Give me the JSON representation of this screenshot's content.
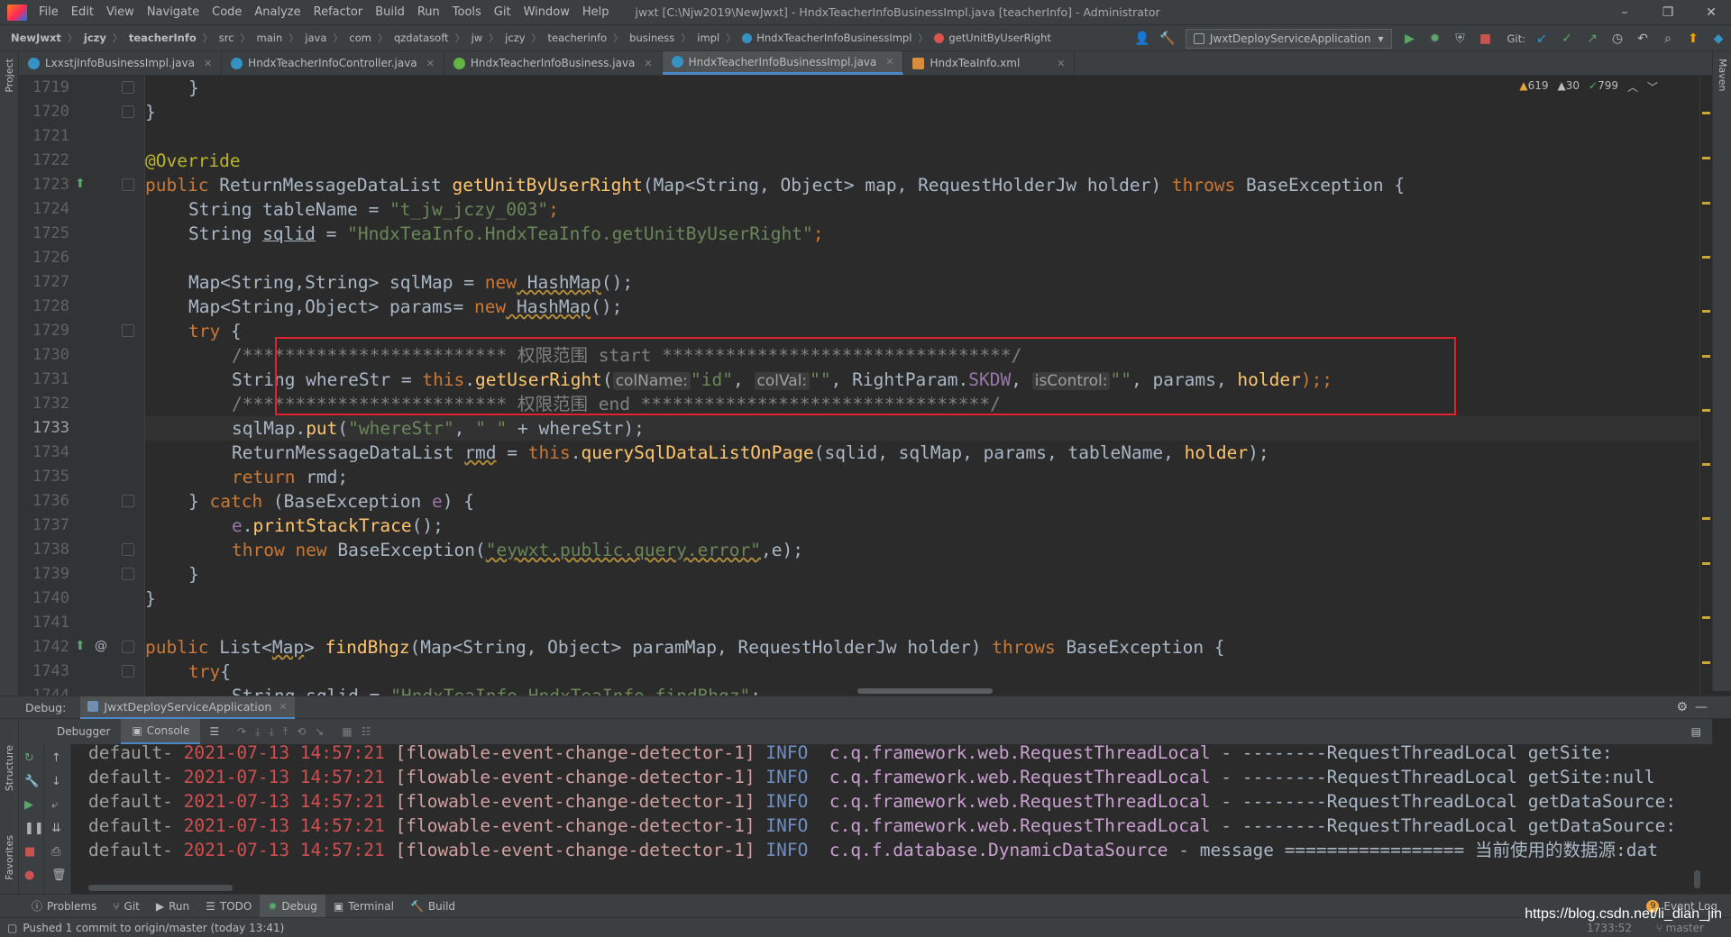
{
  "menu": {
    "items": [
      "File",
      "Edit",
      "View",
      "Navigate",
      "Code",
      "Analyze",
      "Refactor",
      "Build",
      "Run",
      "Tools",
      "Git",
      "Window",
      "Help"
    ],
    "title": "jwxt [C:\\Njw2019\\NewJwxt] - HndxTeacherInfoBusinessImpl.java [teacherInfo] - Administrator",
    "minimize": "–",
    "maximize": "❐",
    "close": "✕"
  },
  "breadcrumb": [
    "NewJwxt",
    "jczy",
    "teacherInfo",
    "src",
    "main",
    "java",
    "com",
    "qzdatasoft",
    "jw",
    "jczy",
    "teacherinfo",
    "business",
    "impl",
    "HndxTeacherInfoBusinessImpl",
    "getUnitByUserRight"
  ],
  "toolbar": {
    "run_config": "JwxtDeployServiceApplication",
    "git_label": "Git:"
  },
  "tabs": [
    {
      "label": "LxxstjInfoBusinessImpl.java",
      "color": "#3592c4"
    },
    {
      "label": "HndxTeacherInfoController.java",
      "color": "#3592c4"
    },
    {
      "label": "HndxTeacherInfoBusiness.java",
      "color": "#62b543"
    },
    {
      "label": "HndxTeacherInfoBusinessImpl.java",
      "color": "#3592c4"
    },
    {
      "label": "HndxTeaInfo.xml",
      "color": "#d88c3d"
    }
  ],
  "inspections": {
    "warnings": "619",
    "weak_warnings": "30",
    "ok": "799"
  },
  "side_labels": {
    "project": "Project",
    "structure": "Structure",
    "favorites": "Favorites",
    "maven": "Maven"
  },
  "line_numbers": [
    "1719",
    "1720",
    "1721",
    "1722",
    "1723",
    "1724",
    "1725",
    "1726",
    "1727",
    "1728",
    "1729",
    "1730",
    "1731",
    "1732",
    "1733",
    "1734",
    "1735",
    "1736",
    "1737",
    "1738",
    "1739",
    "1740",
    "1741",
    "1742",
    "1743",
    "1744"
  ],
  "code": {
    "l1719": "}",
    "l1720": "}",
    "l1722": "@Override",
    "l1723_kw": "public",
    "l1723_type": "ReturnMessageDataList",
    "l1723_fn": "getUnitByUserRight",
    "l1723_args": "(Map<String, Object> map, RequestHolderJw holder)",
    "l1723_throws": "throws",
    "l1723_exc": "BaseException {",
    "l1724_a": "String tableName = ",
    "l1724_s": "\"t_jw_jczy_003\"",
    "l1724_b": ";",
    "l1725_a": "String ",
    "l1725_v": "sqlid",
    "l1725_b": " = ",
    "l1725_s": "\"HndxTeaInfo.HndxTeaInfo.getUnitByUserRight\"",
    "l1725_c": ";",
    "l1727_a": "Map<String,String> sqlMap = ",
    "l1727_new": "new",
    "l1727_b": " HashMap",
    "l1727_c": "();",
    "l1728_a": "Map<String,Object> params= ",
    "l1728_new": "new",
    "l1728_b": " HashMap",
    "l1728_c": "();",
    "l1729_kw": "try",
    "l1729_b": " {",
    "l1730": "/************************* 权限范围 start *********************************/",
    "l1731_a": "String whereStr = ",
    "l1731_this": "this",
    "l1731_dot": ".",
    "l1731_fn": "getUserRight",
    "l1731_p": "(",
    "l1731_h1": "colName:",
    "l1731_s1": "\"id\"",
    "l1731_c1": ", ",
    "l1731_h2": "colVal:",
    "l1731_s2": "\"\"",
    "l1731_c2": ", RightParam.",
    "l1731_fld": "SKDW",
    "l1731_c3": ", ",
    "l1731_h3": "isControl:",
    "l1731_s3": "\"\"",
    "l1731_end": ", params, ",
    "l1731_holder": "holder",
    "l1731_semi": ");;",
    "l1732": "/************************* 权限范围 end *********************************/",
    "l1733_a": "sqlMap.",
    "l1733_fn": "put",
    "l1733_b": "(",
    "l1733_s1": "\"whereStr\"",
    "l1733_c": ", ",
    "l1733_s2": "\" \"",
    "l1733_d": " + whereStr);",
    "l1734_a": "ReturnMessageDataList ",
    "l1734_v": "rmd",
    "l1734_b": " = ",
    "l1734_this": "this",
    "l1734_c": ".",
    "l1734_fn": "querySqlDataListOnPage",
    "l1734_d": "(sqlid, sqlMap, params, tableName, ",
    "l1734_holder": "holder",
    "l1734_e": ");",
    "l1735_kw": "return",
    "l1735_b": " rmd;",
    "l1736_a": "} ",
    "l1736_kw": "catch",
    "l1736_b": " (BaseException ",
    "l1736_v": "e",
    "l1736_c": ") {",
    "l1737_v": "e",
    "l1737_b": ".",
    "l1737_fn": "printStackTrace",
    "l1737_c": "();",
    "l1738_kw": "throw",
    "l1738_new": " new",
    "l1738_b": " BaseException(",
    "l1738_s": "\"eywxt.public.query.error\"",
    "l1738_c": ",e);",
    "l1739": "}",
    "l1740": "}",
    "l1742_kw": "public",
    "l1742_a": " List<",
    "l1742_map": "Map",
    "l1742_b": "> ",
    "l1742_fn": "findBhgz",
    "l1742_c": "(Map<String, Object> paramMap, RequestHolderJw holder) ",
    "l1742_throws": "throws",
    "l1742_d": " BaseException {",
    "l1743_kw": "try",
    "l1743_b": "{",
    "l1744_a": "String sqlid = ",
    "l1744_s": "\"HndxTeaInfo.HndxTeaInfo.findBhgz\"",
    "l1744_b": ";"
  },
  "debug": {
    "label": "Debug:",
    "session": "JwxtDeployServiceApplication",
    "subtabs": [
      "Debugger",
      "Console"
    ]
  },
  "console_lines": [
    {
      "a": "default-",
      "b": "2021-07-13 14:57:21",
      "c": "[flowable-event-change-detector-1]",
      "d": "INFO",
      "e": "c.q.framework.web.RequestThreadLocal",
      "f": "- --------RequestThreadLocal getSite:"
    },
    {
      "a": "default-",
      "b": "2021-07-13 14:57:21",
      "c": "[flowable-event-change-detector-1]",
      "d": "INFO",
      "e": "c.q.framework.web.RequestThreadLocal",
      "f": "- --------RequestThreadLocal getSite:null"
    },
    {
      "a": "default-",
      "b": "2021-07-13 14:57:21",
      "c": "[flowable-event-change-detector-1]",
      "d": "INFO",
      "e": "c.q.framework.web.RequestThreadLocal",
      "f": "- --------RequestThreadLocal getDataSource:"
    },
    {
      "a": "default-",
      "b": "2021-07-13 14:57:21",
      "c": "[flowable-event-change-detector-1]",
      "d": "INFO",
      "e": "c.q.framework.web.RequestThreadLocal",
      "f": "- --------RequestThreadLocal getDataSource:"
    },
    {
      "a": "default-",
      "b": "2021-07-13 14:57:21",
      "c": "[flowable-event-change-detector-1]",
      "d": "INFO",
      "e": "c.q.f.database.DynamicDataSource",
      "f": "- message ================= 当前使用的数据源:dat"
    }
  ],
  "bottom_tools": [
    "Problems",
    "Git",
    "Run",
    "TODO",
    "Debug",
    "Terminal",
    "Build"
  ],
  "event_log": {
    "count": "9",
    "label": "Event Log"
  },
  "status": {
    "message": "Pushed 1 commit to origin/master (today 13:41)",
    "position": "1733:52",
    "branch": "master"
  },
  "watermark": "https://blog.csdn.net/li_dian_jin"
}
